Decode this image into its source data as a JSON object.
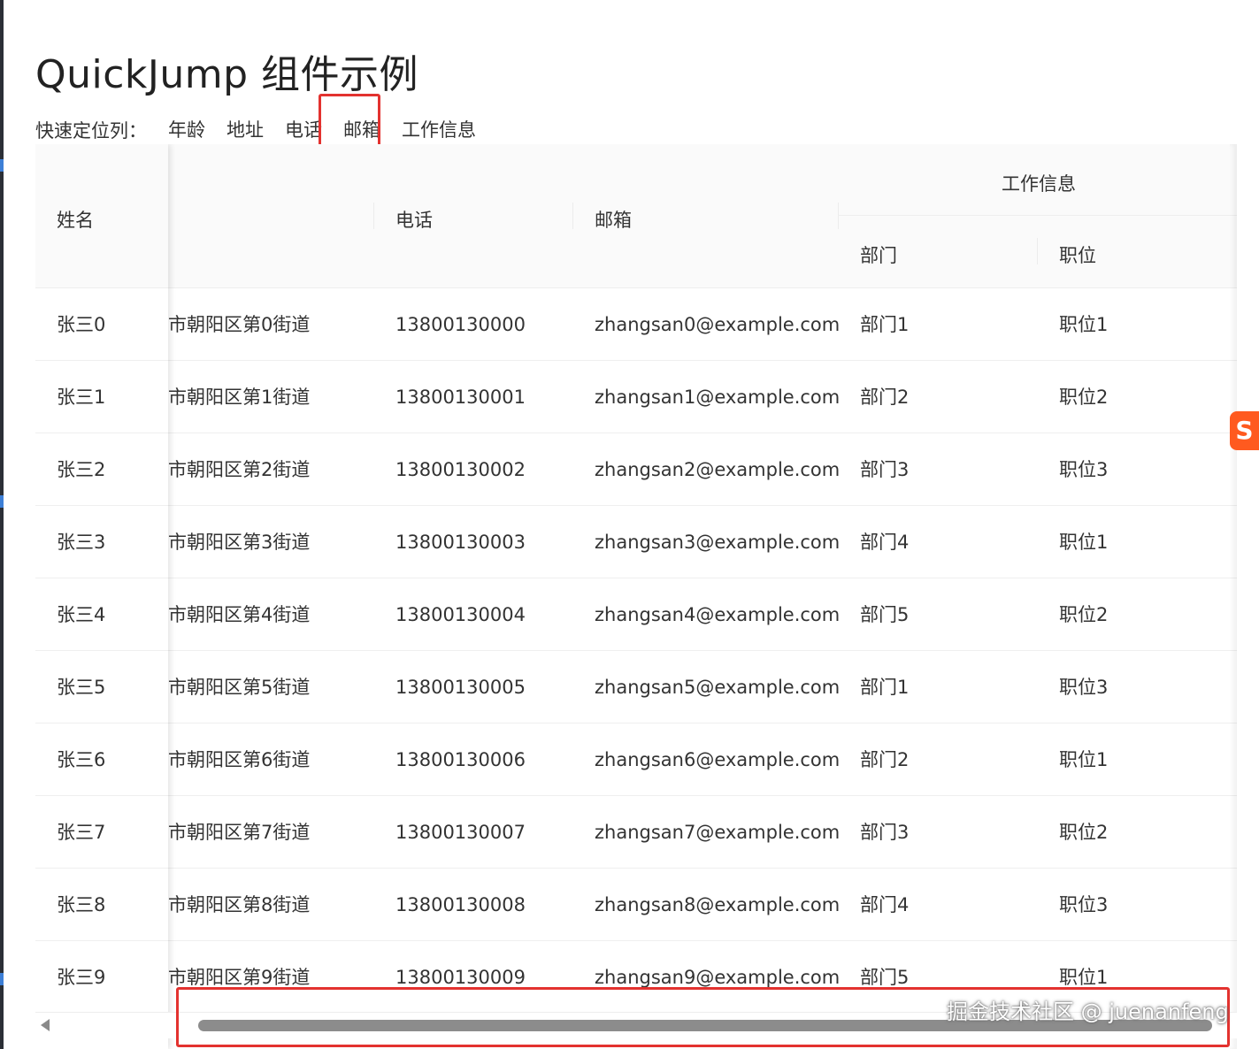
{
  "page": {
    "title": "QuickJump 组件示例"
  },
  "quickjump": {
    "label": "快速定位列：",
    "items": [
      "年龄",
      "地址",
      "电话",
      "邮箱",
      "工作信息"
    ],
    "active": "邮箱"
  },
  "table": {
    "headers": {
      "name": "姓名",
      "address": "",
      "phone": "电话",
      "email": "邮箱",
      "work": "工作信息",
      "department": "部门",
      "position": "职位"
    },
    "rows": [
      {
        "name": "张三0",
        "address": "市朝阳区第0街道",
        "phone": "13800130000",
        "email": "zhangsan0@example.com",
        "department": "部门1",
        "position": "职位1"
      },
      {
        "name": "张三1",
        "address": "市朝阳区第1街道",
        "phone": "13800130001",
        "email": "zhangsan1@example.com",
        "department": "部门2",
        "position": "职位2"
      },
      {
        "name": "张三2",
        "address": "市朝阳区第2街道",
        "phone": "13800130002",
        "email": "zhangsan2@example.com",
        "department": "部门3",
        "position": "职位3"
      },
      {
        "name": "张三3",
        "address": "市朝阳区第3街道",
        "phone": "13800130003",
        "email": "zhangsan3@example.com",
        "department": "部门4",
        "position": "职位1"
      },
      {
        "name": "张三4",
        "address": "市朝阳区第4街道",
        "phone": "13800130004",
        "email": "zhangsan4@example.com",
        "department": "部门5",
        "position": "职位2"
      },
      {
        "name": "张三5",
        "address": "市朝阳区第5街道",
        "phone": "13800130005",
        "email": "zhangsan5@example.com",
        "department": "部门1",
        "position": "职位3"
      },
      {
        "name": "张三6",
        "address": "市朝阳区第6街道",
        "phone": "13800130006",
        "email": "zhangsan6@example.com",
        "department": "部门2",
        "position": "职位1"
      },
      {
        "name": "张三7",
        "address": "市朝阳区第7街道",
        "phone": "13800130007",
        "email": "zhangsan7@example.com",
        "department": "部门3",
        "position": "职位2"
      },
      {
        "name": "张三8",
        "address": "市朝阳区第8街道",
        "phone": "13800130008",
        "email": "zhangsan8@example.com",
        "department": "部门4",
        "position": "职位3"
      },
      {
        "name": "张三9",
        "address": "市朝阳区第9街道",
        "phone": "13800130009",
        "email": "zhangsan9@example.com",
        "department": "部门5",
        "position": "职位1"
      }
    ]
  },
  "watermark": "掘金技术社区 @ juenanfeng",
  "float_badge": "S",
  "colors": {
    "highlight": "#e3322f",
    "header_bg": "#fafafa",
    "badge": "#ff5a1f"
  }
}
